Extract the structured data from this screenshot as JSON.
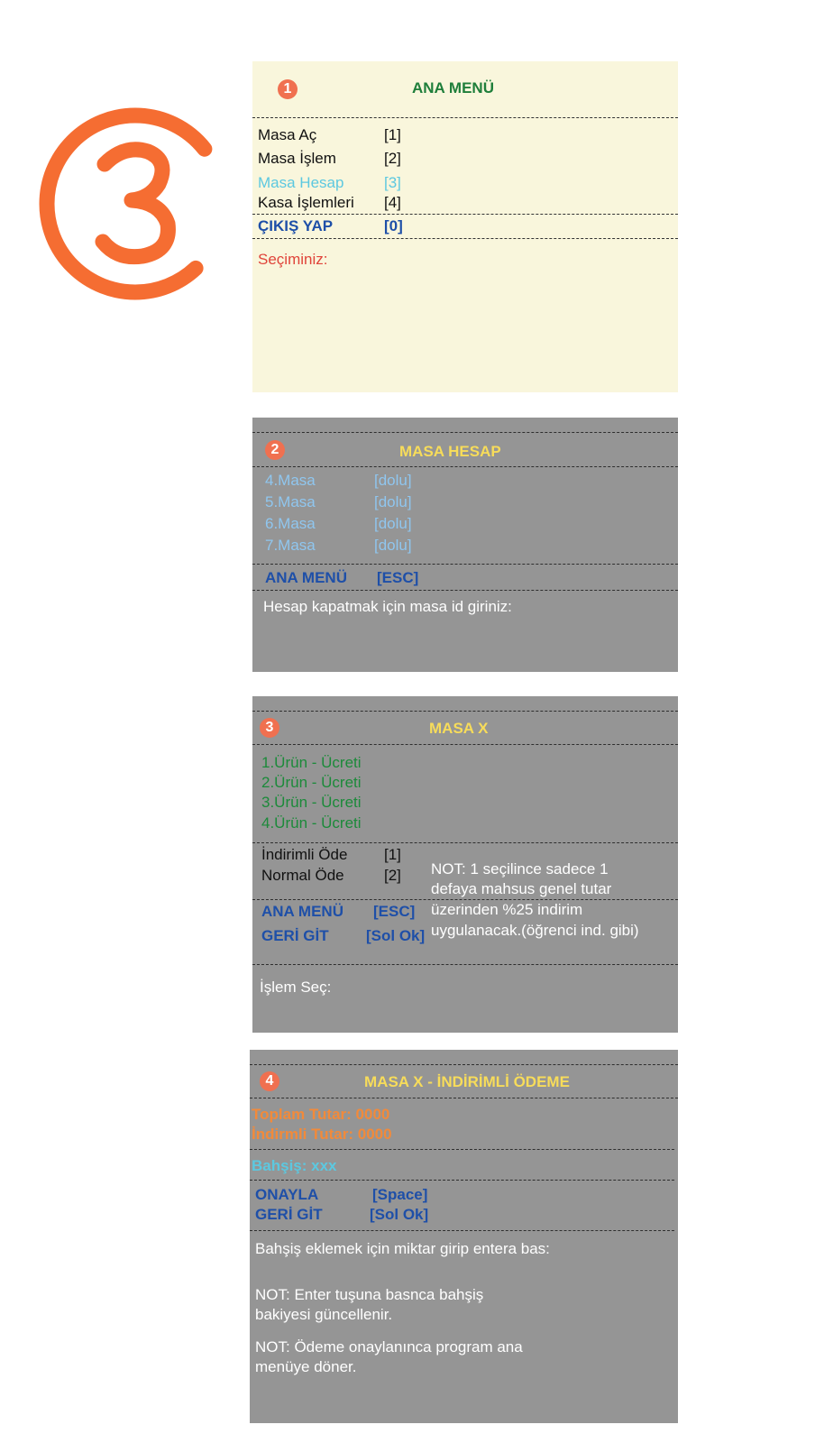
{
  "colors": {
    "accent_orange": "#f56d32",
    "panel_cream": "#f9f6dc",
    "panel_gray": "#959595",
    "title_green": "#1e7e3a",
    "title_yellow": "#f7dc5a",
    "menu_blue": "#1e4fa8",
    "cyan": "#5cc8e0",
    "sky": "#8fc6ef",
    "red_prompt": "#e0443a",
    "green_items": "#1c8a3a",
    "orange_text": "#f28a3a"
  },
  "big_number": "3",
  "panel1": {
    "badge": "1",
    "title": "ANA MENÜ",
    "items": [
      {
        "label": "Masa Aç",
        "key": "[1]"
      },
      {
        "label": "Masa İşlem",
        "key": "[2]"
      },
      {
        "label": "Masa Hesap",
        "key": "[3]"
      },
      {
        "label": "Kasa İşlemleri",
        "key": "[4]"
      }
    ],
    "exit_label": "ÇIKIŞ YAP",
    "exit_key": "[0]",
    "prompt": "Seçiminiz:"
  },
  "panel2": {
    "badge": "2",
    "title": "MASA HESAP",
    "tables": [
      {
        "label": "4.Masa",
        "status": "[dolu]"
      },
      {
        "label": "5.Masa",
        "status": "[dolu]"
      },
      {
        "label": "6.Masa",
        "status": "[dolu]"
      },
      {
        "label": "7.Masa",
        "status": "[dolu]"
      }
    ],
    "menu_label": "ANA MENÜ",
    "menu_key": "[ESC]",
    "prompt": "Hesap kapatmak için masa id giriniz:"
  },
  "panel3": {
    "badge": "3",
    "title": "MASA X",
    "products": [
      "1.Ürün  - Ücreti",
      "2.Ürün  - Ücreti",
      "3.Ürün  - Ücreti",
      "4.Ürün  - Ücreti"
    ],
    "options": [
      {
        "label": "İndirimli Öde",
        "key": "[1]"
      },
      {
        "label": "Normal Öde",
        "key": "[2]"
      }
    ],
    "note_lines": [
      "NOT: 1 seçilince sadece 1",
      "defaya mahsus genel tutar",
      "üzerinden %25 indirim",
      "uygulanacak.(öğrenci ind. gibi)"
    ],
    "menu_label": "ANA MENÜ",
    "menu_key": "[ESC]",
    "back_label": "GERİ GİT",
    "back_key": "[Sol Ok]",
    "prompt": "İşlem Seç:"
  },
  "panel4": {
    "badge": "4",
    "title": "MASA X - İNDİRİMLİ ÖDEME",
    "total": "Toplam Tutar: 0000",
    "discounted": "İndirmli Tutar: 0000",
    "tip": "Bahşiş: xxx",
    "confirm_label": "ONAYLA",
    "confirm_key": "[Space]",
    "back_label": "GERİ GİT",
    "back_key": "[Sol Ok]",
    "prompt": "Bahşiş eklemek için miktar girip entera bas:",
    "note1_lines": [
      "NOT: Enter tuşuna basnca bahşiş",
      "bakiyesi güncellenir."
    ],
    "note2_lines": [
      "NOT: Ödeme onaylanınca program ana",
      "menüye döner."
    ]
  }
}
